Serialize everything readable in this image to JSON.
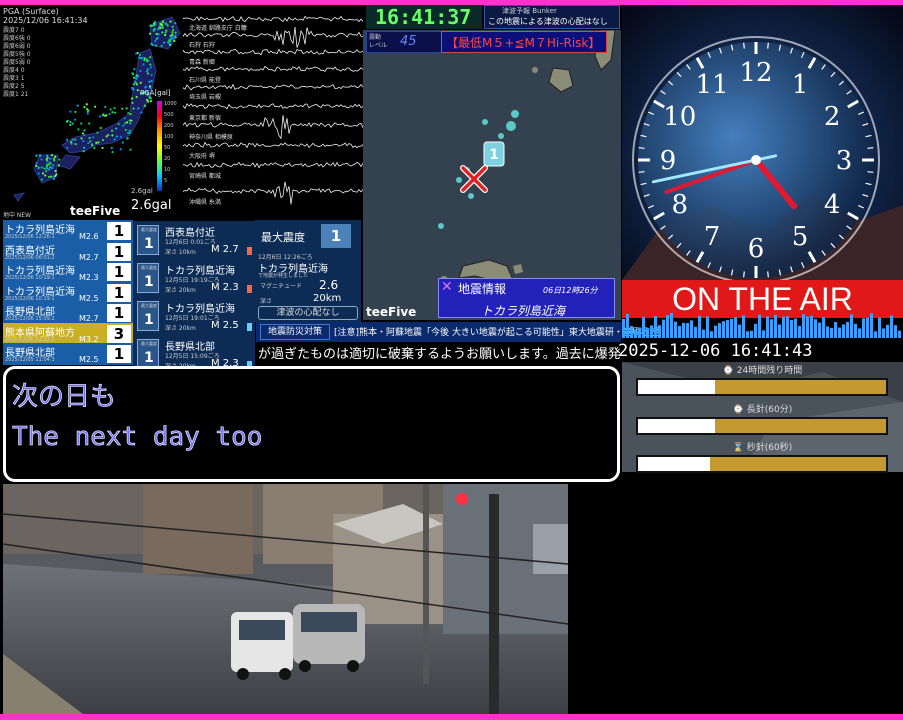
{
  "map": {
    "title": "PGA (Surface)",
    "timestamp": "2025/12/06 16:41:34",
    "stats": "震度7 0\n震度6強 0\n震度6弱 0\n震度5強 0\n震度5弱 0\n震度4 0\n震度3 1\n震度2 5\n震度1 21",
    "pga_title": "PGA[gal]",
    "pga_ticks": "1000\n500\n200\n100\n50\n20\n10\n5",
    "pga_min": "2.6gal",
    "pga_value": "2.6gal"
  },
  "waves": [
    {
      "label": "北海道 釧路支庁 白糠"
    },
    {
      "label": "石狩 石狩"
    },
    {
      "label": "青森 新郷"
    },
    {
      "label": "石川県 能登"
    },
    {
      "label": "埼玉県 岩槻"
    },
    {
      "label": "東京都 新宿"
    },
    {
      "label": "神奈川県 相模原"
    },
    {
      "label": "大阪府 堺"
    },
    {
      "label": "宮崎県 都城"
    },
    {
      "label": "沖縄県 糸満"
    }
  ],
  "header": {
    "clock": "16:41:37",
    "tsunami_label": "津波予報 Bunker",
    "tsunami_text": "この地震による津波の心配はなし"
  },
  "filter": {
    "level_label": "震動\nレベル",
    "level_value": "45",
    "text": "【最低M５+≦M７Hi-Risk】"
  },
  "eq_info": {
    "title": "地震情報",
    "time": "06日12時26分",
    "place": "トカラ列島近海"
  },
  "brand": {
    "teefive": "teeFive"
  },
  "eq_list": {
    "head": "地中 NEW",
    "rows": [
      {
        "name": "トカラ列島近海",
        "date": "2025/12/06 12:26:1",
        "mag": "M2.6",
        "int": "1",
        "bg": "#1a5ea8"
      },
      {
        "name": "西表島付近",
        "date": "2025/12/06 06:01:2",
        "mag": "M2.7",
        "int": "1",
        "bg": "#1a5ea8"
      },
      {
        "name": "トカラ列島近海",
        "date": "2025/12/06 10:19:1",
        "mag": "M2.3",
        "int": "1",
        "bg": "#1a5ea8"
      },
      {
        "name": "トカラ列島近海",
        "date": "2025/12/06 10:19:1",
        "mag": "M2.5",
        "int": "1",
        "bg": "#1a5ea8"
      },
      {
        "name": "長野県北部",
        "date": "2025/12/06 15:09:2",
        "mag": "M2.7",
        "int": "1",
        "bg": "#1a5ea8"
      },
      {
        "name": "熊本県阿蘇地方",
        "date": "2025/12/06 12:32:1",
        "mag": "M3.2",
        "int": "3",
        "bg": "#c9b020"
      },
      {
        "name": "長野県北部",
        "date": "2025/12/05 11:04:3",
        "mag": "M2.5",
        "int": "1",
        "bg": "#1a5ea8"
      }
    ]
  },
  "cards": [
    {
      "int": "1",
      "place": "西表島付近",
      "time": "12月6日 0:01ごろ",
      "depth": "深さ 10km",
      "mag": "M 2.7",
      "sq": "#ff6644"
    },
    {
      "int": "1",
      "place": "トカラ列島近海",
      "time": "12月5日 19:19ごろ",
      "depth": "深さ 20km",
      "mag": "M 2.3",
      "sq": "#ff6644"
    },
    {
      "int": "1",
      "place": "トカラ列島近海",
      "time": "12月5日 19:01ごろ",
      "depth": "深さ 20km",
      "mag": "M 2.5",
      "sq": "#66ccff"
    },
    {
      "int": "1",
      "place": "長野県北部",
      "time": "12月5日 15:09ごろ",
      "depth": "深さ 20km",
      "mag": "M 2.3",
      "sq": "#66ccff"
    }
  ],
  "card_int_label": "最大震度",
  "maxint": {
    "label": "最大震度",
    "value": "1",
    "time": "12月6日 12:26ごろ",
    "place": "トカラ列島近海",
    "origin": "で地震が発生しました",
    "mag_label": "マグニチュード",
    "mag_value": "2.6",
    "depth_label": "深さ",
    "depth_value": "20km",
    "tsunami": "津波の心配なし"
  },
  "ticker": {
    "tag": "地震防災対策",
    "text": "[注意]熊本・阿蘇地震「今後 大きい地震が起こる可能性」東大地震研・笠原教授",
    "scroll": "が過ぎたものは適切に破棄するようお願いします。過去に爆発した例が"
  },
  "subtitle": {
    "ja": "次の日も",
    "en": "The next day too"
  },
  "clock_numbers": [
    "12",
    "1",
    "2",
    "3",
    "4",
    "5",
    "6",
    "7",
    "8",
    "9",
    "10",
    "11"
  ],
  "clock_time": {
    "hour": 4,
    "minute": 41,
    "second": 43
  },
  "onair": "ON THE AIR",
  "datetime": "2025-12-06 16:41:43",
  "progress": [
    {
      "label": "⌚ 24時間残り時間",
      "fraction": 0.31
    },
    {
      "label": "⌚ 長針(60分)",
      "fraction": 0.31
    },
    {
      "label": "⌛ 秒針(60秒)",
      "fraction": 0.29
    }
  ],
  "colors": {
    "accent": "#ff33cc",
    "onair": "#e01818",
    "clock_digital": "#66ff66",
    "sea": "#33424e"
  }
}
